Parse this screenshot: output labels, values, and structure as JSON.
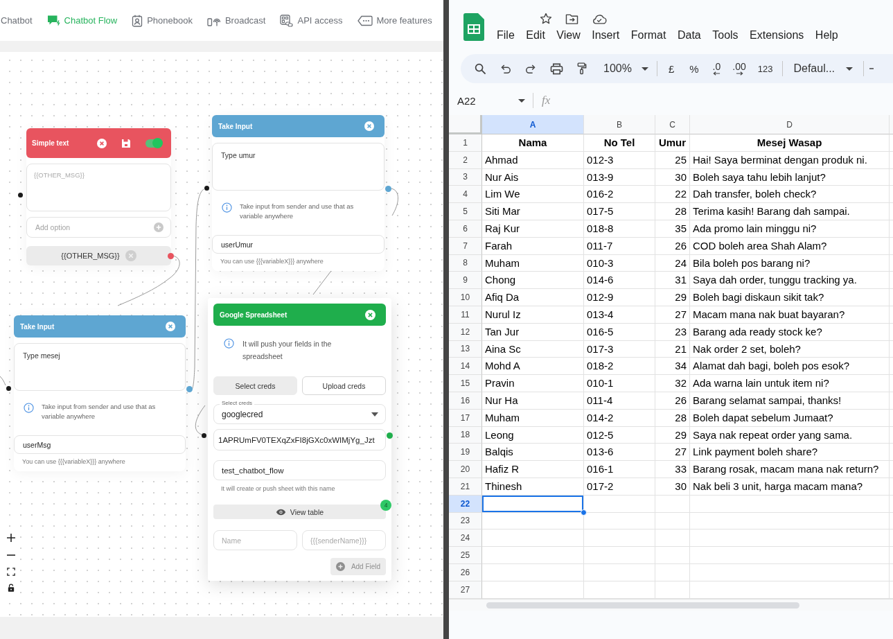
{
  "flow_builder": {
    "nav": [
      {
        "label": "Chatbot",
        "selected": false
      },
      {
        "label": "Chatbot Flow",
        "selected": true
      },
      {
        "label": "Phonebook",
        "selected": false
      },
      {
        "label": "Broadcast",
        "selected": false
      },
      {
        "label": "API access",
        "selected": false
      },
      {
        "label": "More features",
        "selected": false
      }
    ],
    "nodes": [
      {
        "kind": "simple_text",
        "title": "Simple text",
        "enabled": true,
        "message_placeholder": "{{OTHER_MSG}}",
        "option_placeholder": "Add option",
        "options": [
          "{{OTHER_MSG}}"
        ]
      },
      {
        "kind": "take_input",
        "title": "Take Input",
        "message": "Type umur",
        "info": "Take input from sender and use that as variable anywhere",
        "variable": "userUmur",
        "hint": "You can use {{{variableX}}} anywhere"
      },
      {
        "kind": "take_input",
        "title": "Take Input",
        "message": "Type mesej",
        "info": "Take input from sender and use that as variable anywhere",
        "variable": "userMsg",
        "hint": "You can use {{{variableX}}} anywhere"
      },
      {
        "kind": "google_sheet",
        "title": "Google Spreadsheet",
        "info": "It will push your fields in the spreadsheet",
        "cred_tabs": [
          {
            "label": "Select creds",
            "selected": true
          },
          {
            "label": "Upload creds",
            "selected": false
          }
        ],
        "creds_label": "Select creds",
        "creds_value": "googlecred",
        "sheet_id": "1APRUmFV0TEXqZxFI8jGXc0xWIMjYg_Jzt",
        "sheet_name": "test_chatbot_flow",
        "sheet_name_hint": "It will create or push sheet with this name",
        "view_table": "View table",
        "field_count": "4",
        "field_name_placeholder": "Name",
        "field_value_placeholder": "{{{senderName}}}",
        "add_field": {
          "label": "Add Field",
          "disabled": true
        }
      }
    ]
  },
  "spreadsheet": {
    "menu": [
      "File",
      "Edit",
      "View",
      "Insert",
      "Format",
      "Data",
      "Tools",
      "Extensions",
      "Help"
    ],
    "toolbar": {
      "zoom": "100%",
      "currency": "£",
      "percent": "%",
      "decrease_decimal": ".0",
      "increase_decimal": ".00",
      "number_format": "123",
      "font": "Defaul..."
    },
    "name_box": "A22",
    "formula_label": "fx",
    "columns": [
      {
        "label": "A",
        "selected": true,
        "kind": "text"
      },
      {
        "label": "B",
        "selected": false,
        "kind": "text"
      },
      {
        "label": "C",
        "selected": false,
        "kind": "number"
      },
      {
        "label": "D",
        "selected": false,
        "kind": "text"
      }
    ],
    "rows": [
      {
        "number": "1",
        "kind": "header",
        "selected": false,
        "cells": [
          "Nama",
          "No Tel",
          "Umur",
          "Mesej Wasap"
        ]
      },
      {
        "number": "2",
        "kind": "data",
        "selected": false,
        "cells": [
          "Ahmad",
          "012-3",
          "25",
          "Hai! Saya berminat dengan produk ni."
        ]
      },
      {
        "number": "3",
        "kind": "data",
        "selected": false,
        "cells": [
          "Nur Ais",
          "013-9",
          "30",
          "Boleh saya tahu lebih lanjut?"
        ]
      },
      {
        "number": "4",
        "kind": "data",
        "selected": false,
        "cells": [
          "Lim We",
          "016-2",
          "22",
          "Dah transfer, boleh check?"
        ]
      },
      {
        "number": "5",
        "kind": "data",
        "selected": false,
        "cells": [
          "Siti Mar",
          "017-5",
          "28",
          "Terima kasih! Barang dah sampai."
        ]
      },
      {
        "number": "6",
        "kind": "data",
        "selected": false,
        "cells": [
          "Raj Kur",
          "018-8",
          "35",
          "Ada promo lain minggu ni?"
        ]
      },
      {
        "number": "7",
        "kind": "data",
        "selected": false,
        "cells": [
          "Farah",
          "011-7",
          "26",
          "COD boleh area Shah Alam?"
        ]
      },
      {
        "number": "8",
        "kind": "data",
        "selected": false,
        "cells": [
          "Muham",
          "010-3",
          "24",
          "Bila boleh pos barang ni?"
        ]
      },
      {
        "number": "9",
        "kind": "data",
        "selected": false,
        "cells": [
          "Chong",
          "014-6",
          "31",
          "Saya dah order, tunggu tracking ya."
        ]
      },
      {
        "number": "10",
        "kind": "data",
        "selected": false,
        "cells": [
          "Afiq Da",
          "012-9",
          "29",
          "Boleh bagi diskaun sikit tak?"
        ]
      },
      {
        "number": "11",
        "kind": "data",
        "selected": false,
        "cells": [
          "Nurul Iz",
          "013-4",
          "27",
          "Macam mana nak buat bayaran?"
        ]
      },
      {
        "number": "12",
        "kind": "data",
        "selected": false,
        "cells": [
          "Tan Jur",
          "016-5",
          "23",
          "Barang ada ready stock ke?"
        ]
      },
      {
        "number": "13",
        "kind": "data",
        "selected": false,
        "cells": [
          "Aina Sc",
          "017-3",
          "21",
          "Nak order 2 set, boleh?"
        ]
      },
      {
        "number": "14",
        "kind": "data",
        "selected": false,
        "cells": [
          "Mohd A",
          "018-2",
          "34",
          "Alamat dah bagi, boleh pos esok?"
        ]
      },
      {
        "number": "15",
        "kind": "data",
        "selected": false,
        "cells": [
          "Pravin",
          "010-1",
          "32",
          "Ada warna lain untuk item ni?"
        ]
      },
      {
        "number": "16",
        "kind": "data",
        "selected": false,
        "cells": [
          "Nur Ha",
          "011-4",
          "26",
          "Barang selamat sampai, thanks!"
        ]
      },
      {
        "number": "17",
        "kind": "data",
        "selected": false,
        "cells": [
          "Muham",
          "014-2",
          "28",
          "Boleh dapat sebelum Jumaat?"
        ]
      },
      {
        "number": "18",
        "kind": "data",
        "selected": false,
        "cells": [
          "Leong",
          "012-5",
          "29",
          "Saya nak repeat order yang sama."
        ]
      },
      {
        "number": "19",
        "kind": "data",
        "selected": false,
        "cells": [
          "Balqis",
          "013-6",
          "27",
          "Link payment boleh share?"
        ]
      },
      {
        "number": "20",
        "kind": "data",
        "selected": false,
        "cells": [
          "Hafiz R",
          "016-1",
          "33",
          "Barang rosak, macam mana nak return?"
        ]
      },
      {
        "number": "21",
        "kind": "data",
        "selected": false,
        "cells": [
          "Thinesh",
          "017-2",
          "30",
          "Nak beli 3 unit, harga macam mana?"
        ]
      },
      {
        "number": "22",
        "kind": "blank",
        "selected": true
      },
      {
        "number": "23",
        "kind": "blank",
        "selected": false
      },
      {
        "number": "24",
        "kind": "blank",
        "selected": false
      },
      {
        "number": "25",
        "kind": "blank",
        "selected": false
      },
      {
        "number": "26",
        "kind": "blank",
        "selected": false
      },
      {
        "number": "27",
        "kind": "blank",
        "selected": false
      }
    ]
  }
}
